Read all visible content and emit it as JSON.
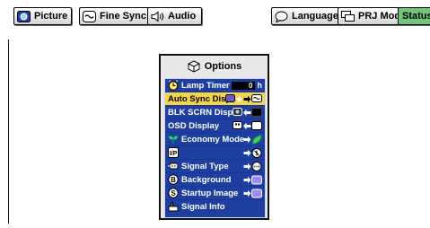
{
  "tabs": [
    {
      "label": "Picture",
      "icon": "picture-icon"
    },
    {
      "label": "Fine Sync",
      "icon": "fine-sync-icon"
    },
    {
      "label": "Audio",
      "icon": "speaker-icon"
    },
    {
      "label": "Language",
      "icon": "speech-bubble-icon"
    },
    {
      "label": "PRJ Mode",
      "icon": "projector-icon"
    },
    {
      "label": "Status"
    }
  ],
  "dialog": {
    "title": "Options",
    "items": [
      {
        "label": "Lamp Timer",
        "value": "0",
        "unit": "h"
      },
      {
        "label": "Auto Sync Disp",
        "selected": true
      },
      {
        "label": "BLK SCRN Disp"
      },
      {
        "label": "OSD Display"
      },
      {
        "label": "Economy Mode"
      },
      {
        "label": "",
        "disabled": true
      },
      {
        "label": "Signal Type"
      },
      {
        "label": "Background"
      },
      {
        "label": "Startup Image"
      },
      {
        "label": "Signal Info"
      }
    ]
  },
  "colors": {
    "menu_bg": "#1f3fa0",
    "highlight": "#f3d54a",
    "status_tab": "#6fc67b"
  }
}
